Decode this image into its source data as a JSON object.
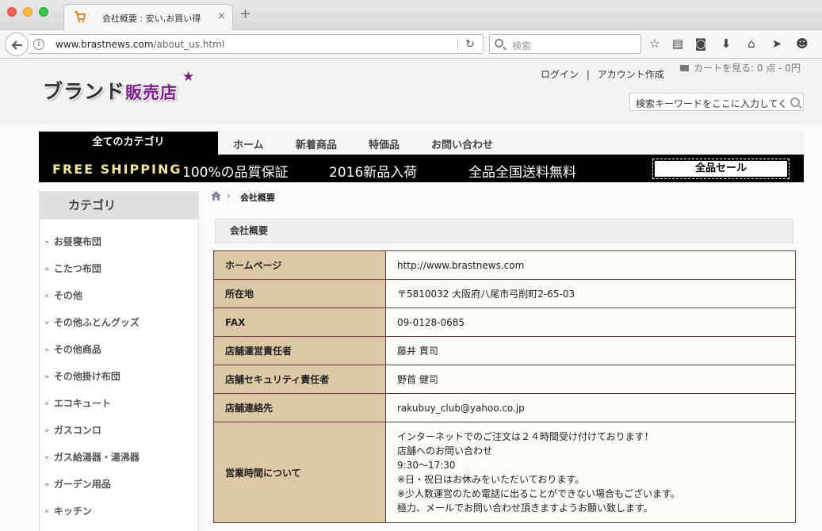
{
  "browser": {
    "tab_title": "会社概要 : 安い,お買い得",
    "url_host": "www.brastnews.com",
    "url_path": "/about_us.html",
    "search_placeholder": "検索",
    "tab_close": "×",
    "new_tab": "+"
  },
  "header": {
    "logo_main": "ブランド",
    "logo_accent": "販売店",
    "login": "ログイン",
    "separator": "|",
    "create_account": "アカウント作成",
    "cart": "カートを見る:  0 点 - 0円",
    "search_value": "検索キーワードをここに入力してく"
  },
  "menu": {
    "all_categories": "全てのカテゴリ",
    "items": [
      "ホーム",
      "新着商品",
      "特価品",
      "お問い合わせ"
    ]
  },
  "banner": {
    "free_shipping": "FREE SHIPPING",
    "quality": "100%の品質保証",
    "new_items": "2016新品入荷",
    "nationwide": "全品全国送料無料",
    "sale": "全品セール"
  },
  "sidebar": {
    "title": "カテゴリ",
    "items": [
      "お昼寝布団",
      "こたつ布団",
      "その他",
      "その他ふとんグッズ",
      "その他商品",
      "その他掛け布団",
      "エコキュート",
      "ガスコンロ",
      "ガス給湯器・湯沸器",
      "ガーデン用品",
      "キッチン"
    ]
  },
  "breadcrumb": {
    "current": "会社概要",
    "sep": "›"
  },
  "content": {
    "title": "会社概要",
    "rows": [
      {
        "k": "ホームページ",
        "v": "http://www.brastnews.com"
      },
      {
        "k": "所在地",
        "v": "〒5810032 大阪府八尾市弓削町2-65-03"
      },
      {
        "k": "FAX",
        "v": "09-0128-0685"
      },
      {
        "k": "店舗運営責任者",
        "v": "藤井 貫司"
      },
      {
        "k": "店舗セキュリティ責任者",
        "v": "野首 健司"
      },
      {
        "k": "店舗連絡先",
        "v": "rakubuy_club@yahoo.co.jp"
      }
    ],
    "hours": {
      "k": "営業時間について",
      "lines": [
        "インターネットでのご注文は２４時間受け付けております！",
        "店舗へのお問い合わせ",
        "9:30～17:30",
        "※日・祝日はお休みをいただいております。",
        "※少人数運営のため電話に出ることができない場合もございます。",
        "極力、メールでお問い合わせ頂きますようお願い致します。"
      ]
    }
  }
}
